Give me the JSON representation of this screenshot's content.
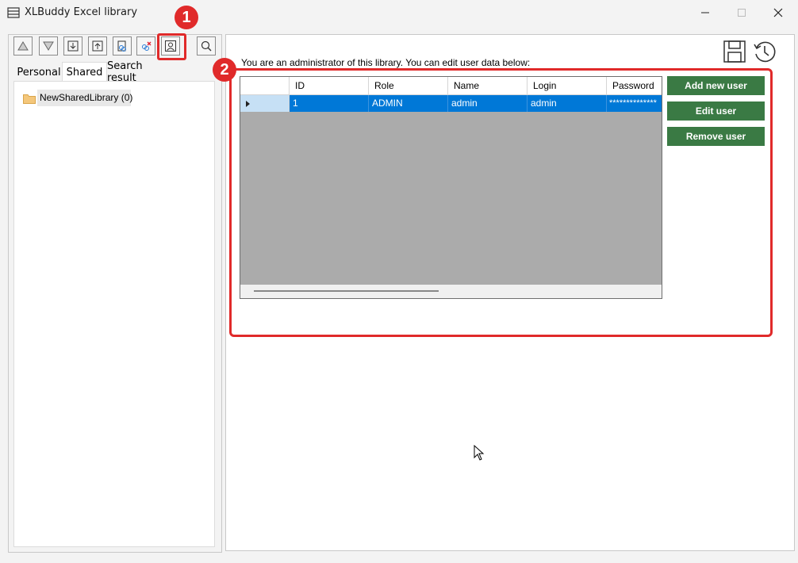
{
  "window": {
    "title": "XLBuddy Excel library",
    "controls": [
      "minimize",
      "maximize",
      "close"
    ]
  },
  "toolbar": {
    "buttons": [
      "move-up-icon",
      "move-down-icon",
      "import-icon",
      "export-icon",
      "link-icon",
      "unlink-icon",
      "user-admin-icon",
      "search-icon"
    ]
  },
  "tabs": [
    {
      "label": "Personal",
      "active": false
    },
    {
      "label": "Shared",
      "active": true
    },
    {
      "label": "Search result",
      "active": false
    }
  ],
  "tree": {
    "items": [
      {
        "label": "NewSharedLibrary (0)",
        "icon": "folder-icon"
      }
    ]
  },
  "right": {
    "message": "You are an administrator of this library. You can edit user data below:"
  },
  "grid": {
    "columns": [
      "ID",
      "Role",
      "Name",
      "Login",
      "Password"
    ],
    "rows": [
      {
        "id": "1",
        "role": "ADMIN",
        "name": "admin",
        "login": "admin",
        "password": "**************"
      }
    ],
    "selected_row": 0
  },
  "buttons": {
    "add": "Add new user",
    "edit": "Edit user",
    "remove": "Remove user"
  },
  "annotations": {
    "badge1": "1",
    "badge2": "2"
  },
  "colors": {
    "accent_green": "#3a7a44",
    "selection_blue": "#0078d7",
    "annotation_red": "#e02a2a"
  }
}
